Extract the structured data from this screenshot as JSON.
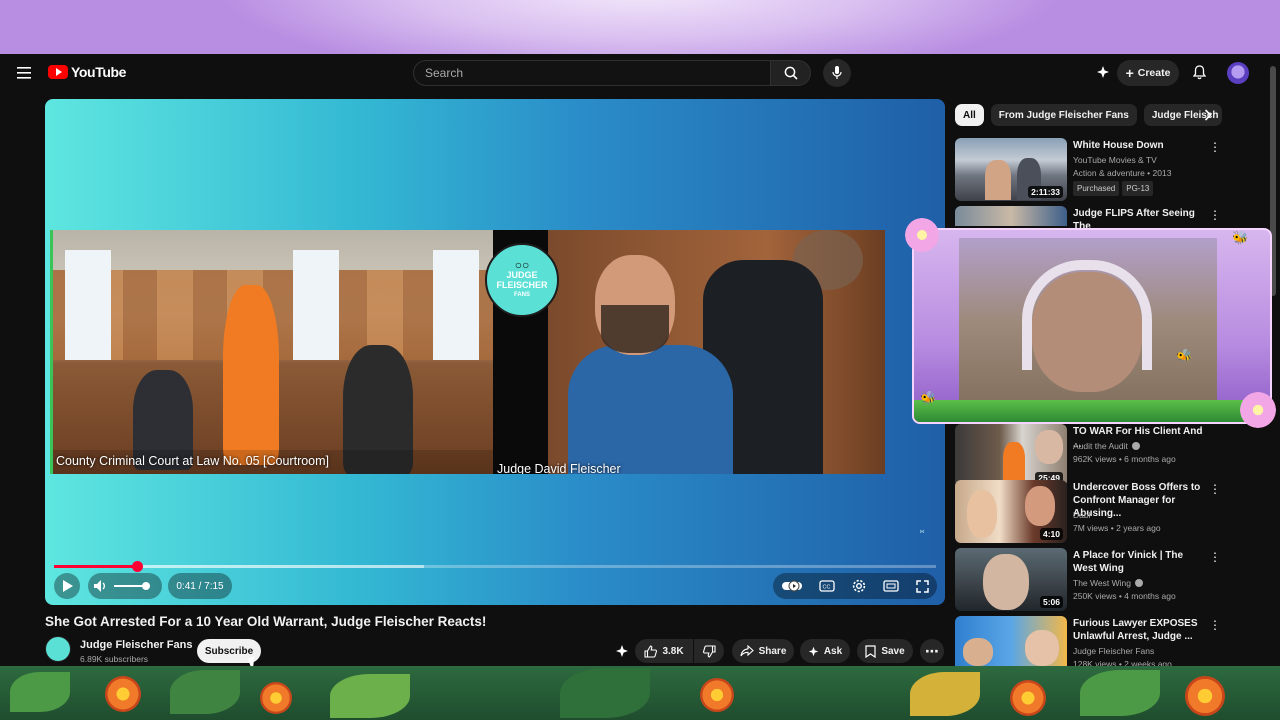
{
  "header": {
    "logo_text": "YouTube",
    "search_placeholder": "Search",
    "create_label": "Create"
  },
  "player": {
    "left_caption": "County Criminal Court at Law No. 05 [Courtroom]",
    "right_caption": "Judge David Fleischer",
    "badge_line1": "JUDGE",
    "badge_line2": "FLEISCHER",
    "badge_line3": "FANS",
    "time": "0:41 / 7:15",
    "progress_played_fraction": 0.094,
    "progress_buffered_fraction": 0.42,
    "volume_level": 1.0
  },
  "video": {
    "title": "She Got Arrested For a 10 Year Old Warrant, Judge Fleischer Reacts!",
    "channel": "Judge Fleischer Fans",
    "subscribers": "6.89K subscribers",
    "subscribe_label": "Subscribe",
    "likes": "3.8K",
    "share_label": "Share",
    "ask_label": "Ask",
    "save_label": "Save"
  },
  "chips": [
    "All",
    "From Judge Fleischer Fans",
    "Judge Fleisch"
  ],
  "recommendations": [
    {
      "title": "White House Down",
      "line1": "YouTube Movies & TV",
      "line2": "Action & adventure • 2013",
      "badges": [
        "Purchased",
        "PG-13"
      ],
      "duration": "2:11:33"
    },
    {
      "title": "Judge FLIPS After Seeing The",
      "line1": "",
      "line2": "",
      "badges": [],
      "duration": ""
    },
    {
      "title": "TO WAR For His Client And ...",
      "line1": "Audit the Audit",
      "line2": "962K views • 6 months ago",
      "badges": [],
      "duration": "25:49"
    },
    {
      "title": "Undercover Boss Offers to Confront Manager for Abusing...",
      "line1": "Dabl",
      "line2": "7M views • 2 years ago",
      "badges": [],
      "duration": "4:10"
    },
    {
      "title": "A Place for Vinick | The West Wing",
      "line1": "The West Wing",
      "line2": "250K views • 4 months ago",
      "badges": [],
      "duration": "5:06"
    },
    {
      "title": "Furious Lawyer EXPOSES Unlawful Arrest, Judge ...",
      "line1": "Judge Fleischer Fans",
      "line2": "128K views • 2 weeks ago",
      "badges": [],
      "duration": ""
    }
  ],
  "colors": {
    "accent_red": "#ff0033",
    "background": "#0f0f0f",
    "chip_bg": "#272727"
  }
}
